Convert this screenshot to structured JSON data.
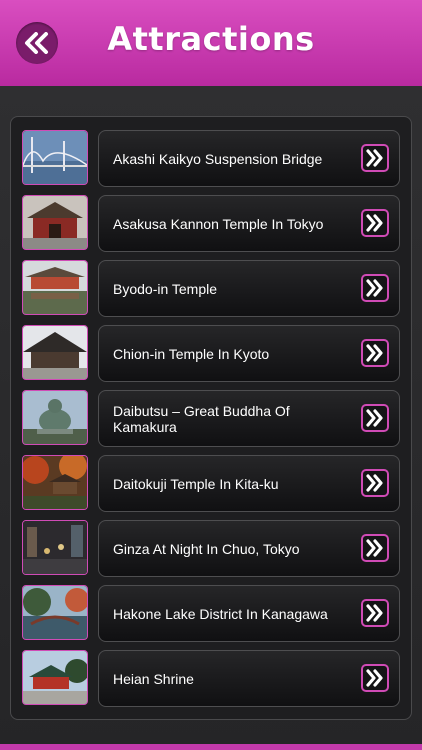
{
  "header": {
    "title": "Attractions",
    "back_icon": "double-chevron-left-icon"
  },
  "colors": {
    "accent": "#c93bb0",
    "header_top": "#d94ec0",
    "header_bottom": "#b92aa0",
    "background": "#2b2b2d",
    "card": "#1a1a1c",
    "text": "#ffffff"
  },
  "attractions": [
    {
      "label": "Akashi Kaikyo Suspension Bridge",
      "thumb": "bridge"
    },
    {
      "label": "Asakusa Kannon Temple In Tokyo",
      "thumb": "temple-gate"
    },
    {
      "label": "Byodo-in Temple",
      "thumb": "temple-lake"
    },
    {
      "label": "Chion-in Temple In Kyoto",
      "thumb": "temple-hall"
    },
    {
      "label": "Daibutsu – Great Buddha Of Kamakura",
      "thumb": "buddha"
    },
    {
      "label": "Daitokuji Temple In Kita-ku",
      "thumb": "temple-autumn"
    },
    {
      "label": "Ginza At Night In Chuo, Tokyo",
      "thumb": "street-night"
    },
    {
      "label": "Hakone Lake District In Kanagawa",
      "thumb": "lake-bridge"
    },
    {
      "label": "Heian Shrine",
      "thumb": "shrine"
    }
  ],
  "row_icon": "double-chevron-right-icon"
}
